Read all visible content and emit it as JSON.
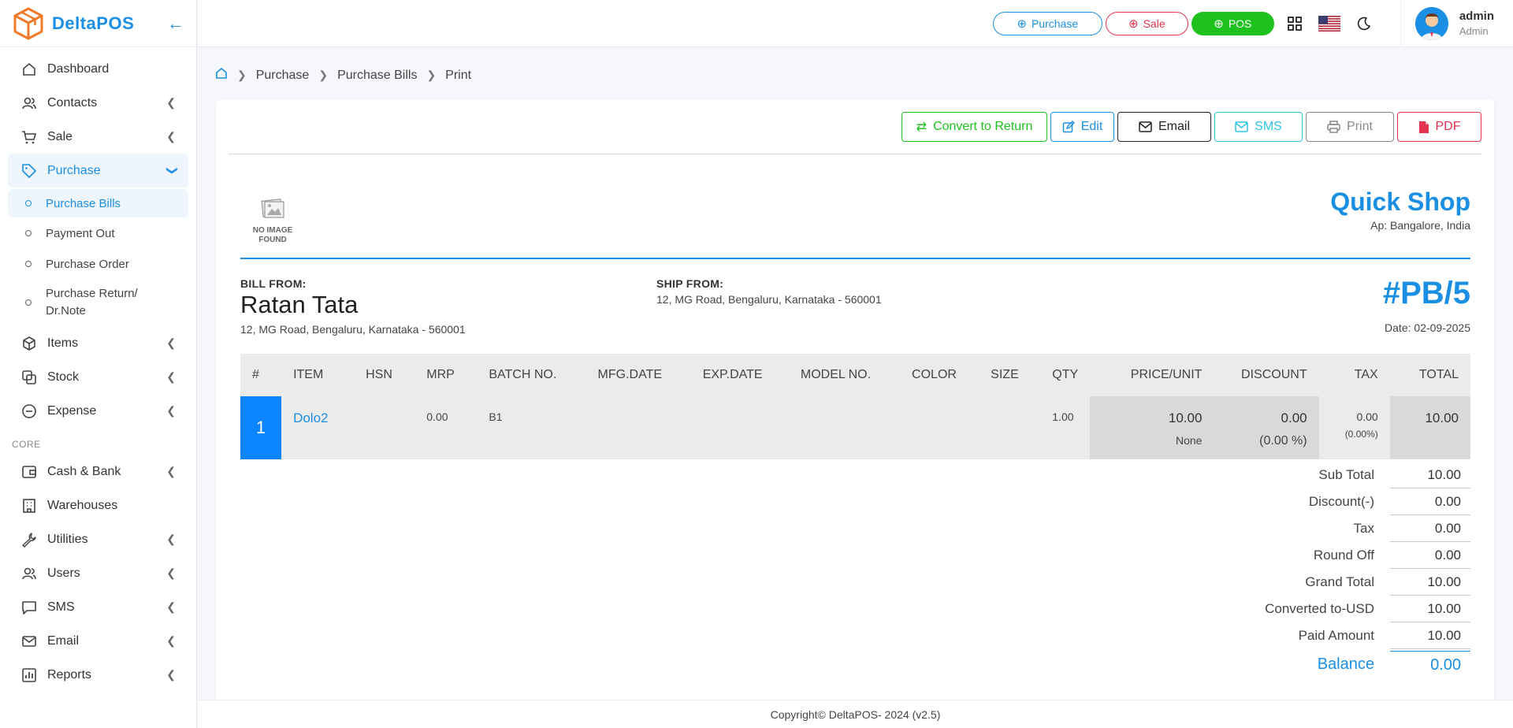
{
  "brand": {
    "name": "DeltaPOS"
  },
  "sidebar": {
    "items": [
      {
        "label": "Dashboard",
        "icon": "home-icon",
        "has_children": false
      },
      {
        "label": "Contacts",
        "icon": "users-icon",
        "has_children": true
      },
      {
        "label": "Sale",
        "icon": "cart-icon",
        "has_children": true
      },
      {
        "label": "Purchase",
        "icon": "tag-icon",
        "has_children": true,
        "expanded": true
      }
    ],
    "purchase_sub": [
      {
        "label": "Purchase Bills",
        "active": true
      },
      {
        "label": "Payment Out"
      },
      {
        "label": "Purchase Order"
      },
      {
        "label": "Purchase Return/ Dr.Note"
      }
    ],
    "items2": [
      {
        "label": "Items",
        "icon": "box-icon"
      },
      {
        "label": "Stock",
        "icon": "stock-icon"
      },
      {
        "label": "Expense",
        "icon": "minus-circle-icon"
      }
    ],
    "core_label": "CORE",
    "core_items": [
      {
        "label": "Cash & Bank",
        "icon": "wallet-icon",
        "has_children": true
      },
      {
        "label": "Warehouses",
        "icon": "building-icon",
        "has_children": false
      },
      {
        "label": "Utilities",
        "icon": "wrench-icon",
        "has_children": true
      },
      {
        "label": "Users",
        "icon": "users-icon",
        "has_children": true
      },
      {
        "label": "SMS",
        "icon": "message-icon",
        "has_children": true
      },
      {
        "label": "Email",
        "icon": "mail-icon",
        "has_children": true
      },
      {
        "label": "Reports",
        "icon": "chart-icon",
        "has_children": true
      }
    ]
  },
  "topbar": {
    "purchase_label": "Purchase",
    "sale_label": "Sale",
    "pos_label": "POS",
    "user_name": "admin",
    "user_role": "Admin"
  },
  "breadcrumb": [
    "Purchase",
    "Purchase Bills",
    "Print"
  ],
  "toolbar": {
    "convert_label": "Convert to Return",
    "edit_label": "Edit",
    "email_label": "Email",
    "sms_label": "SMS",
    "print_label": "Print",
    "pdf_label": "PDF"
  },
  "invoice": {
    "no_image_text": "NO IMAGE FOUND",
    "shop_name": "Quick Shop",
    "shop_address": "Ap: Bangalore, India",
    "bill_from_label": "BILL FROM:",
    "bill_from_name": "Ratan Tata",
    "bill_from_address": "12, MG Road, Bengaluru, Karnataka - 560001",
    "ship_from_label": "SHIP FROM:",
    "ship_from_address": "12, MG Road, Bengaluru, Karnataka - 560001",
    "number": "#PB/5",
    "date": "Date: 02-09-2025"
  },
  "table": {
    "headers": [
      "#",
      "ITEM",
      "HSN",
      "MRP",
      "BATCH NO.",
      "MFG.DATE",
      "EXP.DATE",
      "MODEL NO.",
      "COLOR",
      "SIZE",
      "QTY",
      "PRICE/UNIT",
      "DISCOUNT",
      "TAX",
      "TOTAL"
    ],
    "rows": [
      {
        "idx": "1",
        "item": "Dolo2",
        "hsn": "",
        "mrp": "0.00",
        "batch": "B1",
        "mfg": "",
        "exp": "",
        "model": "",
        "color": "",
        "size": "",
        "qty": "1.00",
        "price": "10.00",
        "price_note": "None",
        "discount": "0.00",
        "discount_pct": "(0.00 %)",
        "tax": "0.00",
        "tax_pct": "(0.00%)",
        "total": "10.00"
      }
    ]
  },
  "totals": [
    {
      "label": "Sub Total",
      "value": "10.00"
    },
    {
      "label": "Discount(-)",
      "value": "0.00"
    },
    {
      "label": "Tax",
      "value": "0.00"
    },
    {
      "label": "Round Off",
      "value": "0.00"
    },
    {
      "label": "Grand Total",
      "value": "10.00"
    },
    {
      "label": "Converted to-USD",
      "value": "10.00"
    },
    {
      "label": "Paid Amount",
      "value": "10.00"
    }
  ],
  "balance": {
    "label": "Balance",
    "value": "0.00"
  },
  "footer": "Copyright© DeltaPOS- 2024 (v2.5)",
  "colors": {
    "accent": "#1a8fe3",
    "success": "#1ec21e",
    "danger": "#e2324f",
    "info": "#2ec5e3",
    "index_blue": "#0a84ff"
  }
}
